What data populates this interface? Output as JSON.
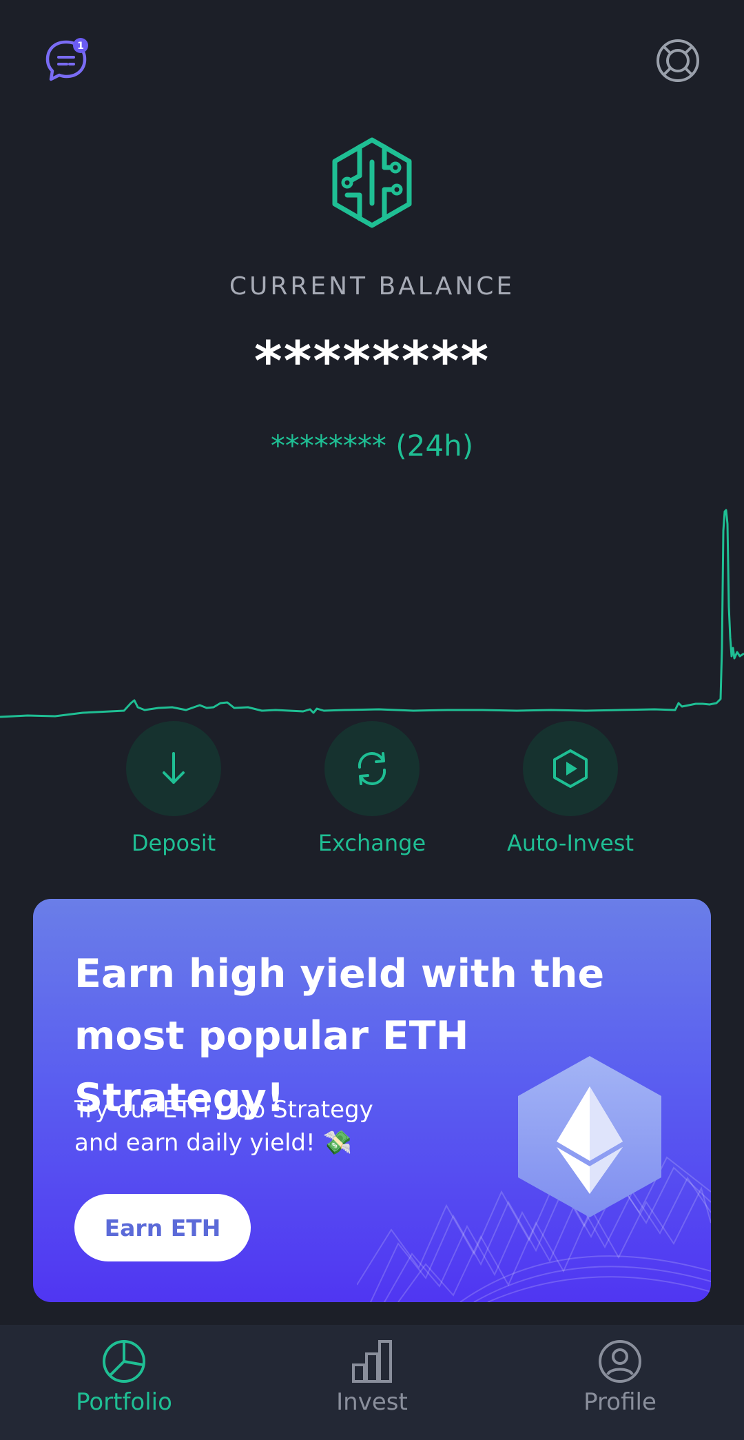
{
  "header": {
    "chat_icon": "chat-bubble-icon",
    "chat_badge": "1",
    "settings_icon": "lifebuoy-icon"
  },
  "balance": {
    "label": "CURRENT BALANCE",
    "value": "********",
    "change_24h": "******** (24h)"
  },
  "chart": {
    "type": "line",
    "color": "#1fbf94"
  },
  "actions": [
    {
      "label": "Deposit",
      "icon": "arrow-down-icon"
    },
    {
      "label": "Exchange",
      "icon": "exchange-icon"
    },
    {
      "label": "Auto-Invest",
      "icon": "play-hexagon-icon"
    }
  ],
  "promo": {
    "title": "Earn high yield with the most popular ETH Strategy!",
    "text": "Try our ETH Lido Strategy and earn daily yield! 💸",
    "button_label": "Earn ETH",
    "icon": "ethereum-icon"
  },
  "nav": {
    "items": [
      {
        "label": "Portfolio",
        "icon": "pie-chart-icon",
        "active": true
      },
      {
        "label": "Invest",
        "icon": "bar-chart-icon",
        "active": false
      },
      {
        "label": "Profile",
        "icon": "user-icon",
        "active": false
      }
    ]
  },
  "colors": {
    "background": "#1c1f28",
    "accent_green": "#1fbf94",
    "accent_purple": "#6b5cf2",
    "nav_background": "#232835",
    "inactive": "#8a8f9c"
  }
}
